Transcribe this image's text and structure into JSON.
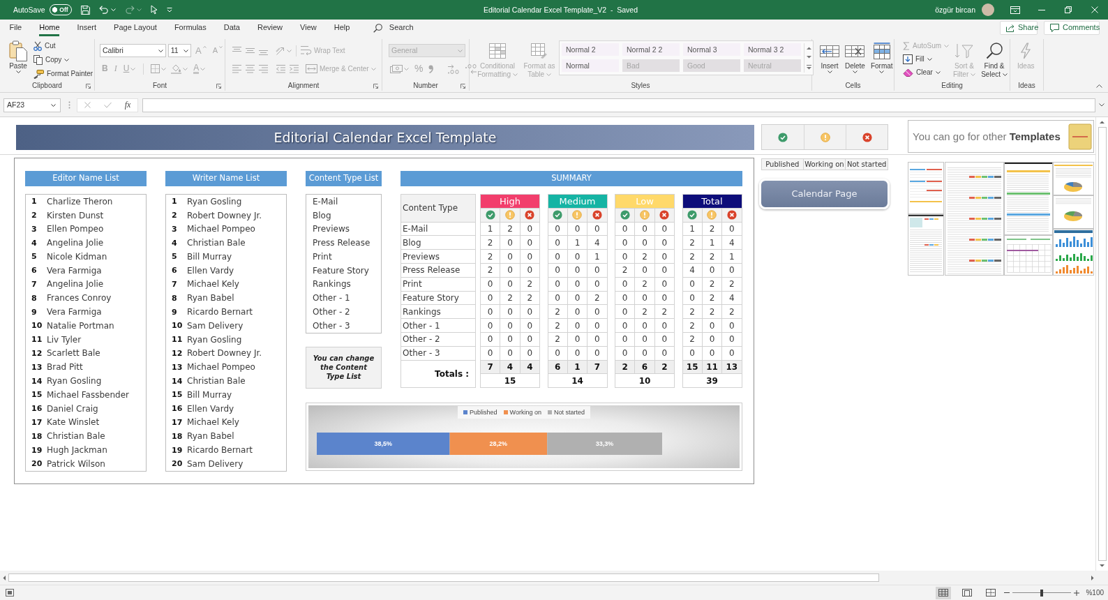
{
  "title_bar": {
    "autosave": {
      "label": "AutoSave",
      "toggle_text": "Off",
      "on": false
    },
    "quick_access": [
      {
        "kind": "save",
        "disabled": false
      },
      {
        "kind": "undo",
        "disabled": false
      },
      {
        "kind": "redo",
        "disabled": true
      },
      {
        "kind": "touch_mode",
        "disabled": false
      },
      {
        "kind": "customize",
        "disabled": false
      }
    ],
    "document_title": "Editorial Calendar Excel Template_V2  -  Saved",
    "user_name": "özgür bircan"
  },
  "ribbon_tabs": [
    {
      "label": "File",
      "selected": false
    },
    {
      "label": "Home",
      "selected": true
    },
    {
      "label": "Insert",
      "selected": false
    },
    {
      "label": "Page Layout",
      "selected": false
    },
    {
      "label": "Formulas",
      "selected": false
    },
    {
      "label": "Data",
      "selected": false
    },
    {
      "label": "Review",
      "selected": false
    },
    {
      "label": "View",
      "selected": false
    },
    {
      "label": "Help",
      "selected": false
    }
  ],
  "tell_me": {
    "label": "Search"
  },
  "share_button": {
    "label": "Share"
  },
  "comments_button": {
    "label": "Comments"
  },
  "ribbon_groups": [
    {
      "kind": "clipboard",
      "label": "Clipboard",
      "launcher": true,
      "commands": [
        {
          "kind": "paste",
          "label": "Paste",
          "disabled": false
        },
        {
          "kind": "cut",
          "label": "Cut",
          "disabled": false
        },
        {
          "kind": "copy",
          "label": "Copy",
          "disabled": false
        },
        {
          "kind": "format_painter",
          "label": "Format Painter",
          "disabled": false
        }
      ]
    },
    {
      "kind": "font",
      "label": "Font",
      "launcher": true,
      "commands": [
        {
          "kind": "font_name",
          "value": "Calibri",
          "disabled": false
        },
        {
          "kind": "font_size",
          "value": "11",
          "disabled": false
        },
        {
          "kind": "grow_font",
          "label": "A",
          "disabled": true
        },
        {
          "kind": "shrink_font",
          "label": "A",
          "disabled": true
        },
        {
          "kind": "bold",
          "label": "B",
          "disabled": true
        },
        {
          "kind": "italic",
          "label": "I",
          "disabled": true
        },
        {
          "kind": "underline",
          "label": "U",
          "disabled": true
        },
        {
          "kind": "borders",
          "disabled": true
        },
        {
          "kind": "fill_color",
          "disabled": true
        },
        {
          "kind": "font_color",
          "label": "A",
          "disabled": true
        }
      ]
    },
    {
      "kind": "alignment",
      "label": "Alignment",
      "launcher": true,
      "commands": [
        {
          "kind": "align_top",
          "disabled": true
        },
        {
          "kind": "align_middle",
          "disabled": true
        },
        {
          "kind": "align_bottom",
          "disabled": true
        },
        {
          "kind": "orientation",
          "disabled": true
        },
        {
          "kind": "wrap_text",
          "label": "Wrap Text",
          "disabled": true
        },
        {
          "kind": "align_left",
          "disabled": true
        },
        {
          "kind": "align_center",
          "disabled": true
        },
        {
          "kind": "align_right",
          "disabled": true
        },
        {
          "kind": "decrease_indent",
          "disabled": true
        },
        {
          "kind": "increase_indent",
          "disabled": true
        },
        {
          "kind": "merge_center",
          "label": "Merge & Center",
          "disabled": true
        }
      ]
    },
    {
      "kind": "number",
      "label": "Number",
      "launcher": true,
      "commands": [
        {
          "kind": "number_format",
          "value": "General",
          "disabled": true
        },
        {
          "kind": "accounting",
          "disabled": true
        },
        {
          "kind": "percent",
          "label": "%",
          "disabled": true
        },
        {
          "kind": "comma",
          "disabled": true
        },
        {
          "kind": "increase_decimal",
          "disabled": true
        },
        {
          "kind": "decrease_decimal",
          "disabled": true
        }
      ]
    },
    {
      "kind": "styles",
      "label": "Styles",
      "launcher": false,
      "commands": [
        {
          "kind": "conditional_formatting",
          "label": "Conditional Formatting",
          "disabled": true
        },
        {
          "kind": "format_as_table",
          "label": "Format as Table",
          "disabled": true
        }
      ],
      "cell_styles": [
        {
          "label": "Normal 2",
          "disabled": false
        },
        {
          "label": "Normal 2 2",
          "disabled": false
        },
        {
          "label": "Normal 3",
          "disabled": false
        },
        {
          "label": "Normal 3 2",
          "disabled": false
        },
        {
          "label": "Normal",
          "disabled": false
        },
        {
          "label": "Bad",
          "disabled": true
        },
        {
          "label": "Good",
          "disabled": true
        },
        {
          "label": "Neutral",
          "disabled": true
        }
      ]
    },
    {
      "kind": "cells",
      "label": "Cells",
      "launcher": false,
      "commands": [
        {
          "kind": "insert",
          "label": "Insert",
          "disabled": false
        },
        {
          "kind": "delete",
          "label": "Delete",
          "disabled": false
        },
        {
          "kind": "format",
          "label": "Format",
          "disabled": false
        }
      ]
    },
    {
      "kind": "editing",
      "label": "Editing",
      "launcher": false,
      "commands": [
        {
          "kind": "autosum",
          "label": "AutoSum",
          "disabled": true
        },
        {
          "kind": "fill",
          "label": "Fill",
          "disabled": false
        },
        {
          "kind": "clear",
          "label": "Clear",
          "disabled": false
        },
        {
          "kind": "sort_filter",
          "label": "Sort & Filter",
          "disabled": true
        },
        {
          "kind": "find_select",
          "label": "Find & Select",
          "disabled": false
        }
      ]
    },
    {
      "kind": "ideas",
      "label": "Ideas",
      "launcher": false,
      "commands": [
        {
          "kind": "ideas",
          "label": "Ideas",
          "disabled": true
        }
      ]
    }
  ],
  "formula_bar": {
    "name_box": "AF23",
    "function_label": "fx"
  },
  "sheet": {
    "banner_title": "Editorial Calendar Excel Template",
    "status_legend": [
      {
        "kind": "published",
        "label": "Published"
      },
      {
        "kind": "working",
        "label": "Working on"
      },
      {
        "kind": "not_started",
        "label": "Not started"
      }
    ],
    "calendar_button": {
      "label": "Calendar Page"
    },
    "templates_promo": {
      "text": "You can go for other **Templates**"
    },
    "editor_list": {
      "title": "Editor Name List",
      "items": [
        {
          "number": "1",
          "name": "Charlize Theron"
        },
        {
          "number": "2",
          "name": "Kirsten Dunst"
        },
        {
          "number": "3",
          "name": "Ellen Pompeo"
        },
        {
          "number": "4",
          "name": "Angelina Jolie"
        },
        {
          "number": "5",
          "name": "Nicole Kidman"
        },
        {
          "number": "6",
          "name": "Vera Farmiga"
        },
        {
          "number": "7",
          "name": "Angelina Jolie"
        },
        {
          "number": "8",
          "name": "Frances Conroy"
        },
        {
          "number": "9",
          "name": "Vera Farmiga"
        },
        {
          "number": "10",
          "name": "Natalie Portman"
        },
        {
          "number": "11",
          "name": "Liv Tyler"
        },
        {
          "number": "12",
          "name": "Scarlett Bale"
        },
        {
          "number": "13",
          "name": "Brad Pitt"
        },
        {
          "number": "14",
          "name": "Ryan Gosling"
        },
        {
          "number": "15",
          "name": "Michael Fassbender"
        },
        {
          "number": "16",
          "name": "Daniel Craig"
        },
        {
          "number": "17",
          "name": "Kate Winslet"
        },
        {
          "number": "18",
          "name": "Christian Bale"
        },
        {
          "number": "19",
          "name": "Hugh Jackman"
        },
        {
          "number": "20",
          "name": "Patrick Wilson"
        }
      ]
    },
    "writer_list": {
      "title": "Writer Name List",
      "items": [
        {
          "number": "1",
          "name": "Ryan Gosling"
        },
        {
          "number": "2",
          "name": "Robert Downey Jr."
        },
        {
          "number": "3",
          "name": "Michael Pompeo"
        },
        {
          "number": "4",
          "name": "Christian Bale"
        },
        {
          "number": "5",
          "name": "Bill Murray"
        },
        {
          "number": "6",
          "name": "Ellen Vardy"
        },
        {
          "number": "7",
          "name": "Michael Kely"
        },
        {
          "number": "8",
          "name": "Ryan Babel"
        },
        {
          "number": "9",
          "name": "Ricardo Bernart"
        },
        {
          "number": "10",
          "name": "Sam Delivery"
        },
        {
          "number": "11",
          "name": "Ryan Gosling"
        },
        {
          "number": "12",
          "name": "Robert Downey Jr."
        },
        {
          "number": "13",
          "name": "Michael Pompeo"
        },
        {
          "number": "14",
          "name": "Christian Bale"
        },
        {
          "number": "15",
          "name": "Bill Murray"
        },
        {
          "number": "16",
          "name": "Ellen Vardy"
        },
        {
          "number": "17",
          "name": "Michael Kely"
        },
        {
          "number": "18",
          "name": "Ryan Babel"
        },
        {
          "number": "19",
          "name": "Ricardo Bernart"
        },
        {
          "number": "20",
          "name": "Sam Delivery"
        }
      ]
    },
    "content_type_list": {
      "title": "Content Type List",
      "items": [
        "E-Mail",
        "Blog",
        "Previews",
        "Press Release",
        "Print",
        "Feature Story",
        "Rankings",
        "Other - 1",
        "Other - 2",
        "Other - 3"
      ],
      "note": "You can change the Content Type List"
    },
    "summary": {
      "title": "SUMMARY",
      "row_header": "Content Type",
      "groups": [
        {
          "label": "High",
          "color": "#f23e6c"
        },
        {
          "label": "Medium",
          "color": "#15b4a4"
        },
        {
          "label": "Low",
          "color": "#ffd96a"
        },
        {
          "label": "Total",
          "color": "#0d0d7a"
        }
      ],
      "rows": [
        {
          "label": "E-Mail",
          "cells": [
            "1",
            "2",
            "0",
            "0",
            "0",
            "0",
            "0",
            "0",
            "0",
            "1",
            "2",
            "0"
          ]
        },
        {
          "label": "Blog",
          "cells": [
            "2",
            "0",
            "0",
            "0",
            "1",
            "4",
            "0",
            "0",
            "0",
            "2",
            "1",
            "4"
          ]
        },
        {
          "label": "Previews",
          "cells": [
            "2",
            "0",
            "0",
            "0",
            "0",
            "1",
            "0",
            "2",
            "0",
            "2",
            "2",
            "1"
          ]
        },
        {
          "label": "Press Release",
          "cells": [
            "2",
            "0",
            "0",
            "0",
            "0",
            "0",
            "2",
            "0",
            "0",
            "4",
            "0",
            "0"
          ]
        },
        {
          "label": "Print",
          "cells": [
            "0",
            "0",
            "2",
            "0",
            "0",
            "0",
            "0",
            "2",
            "0",
            "0",
            "2",
            "2"
          ]
        },
        {
          "label": "Feature Story",
          "cells": [
            "0",
            "2",
            "2",
            "0",
            "0",
            "2",
            "0",
            "0",
            "0",
            "0",
            "2",
            "4"
          ]
        },
        {
          "label": "Rankings",
          "cells": [
            "0",
            "0",
            "0",
            "2",
            "0",
            "0",
            "0",
            "2",
            "2",
            "2",
            "2",
            "2"
          ]
        },
        {
          "label": "Other - 1",
          "cells": [
            "0",
            "0",
            "0",
            "2",
            "0",
            "0",
            "0",
            "0",
            "0",
            "2",
            "0",
            "0"
          ]
        },
        {
          "label": "Other - 2",
          "cells": [
            "0",
            "0",
            "0",
            "2",
            "0",
            "0",
            "0",
            "0",
            "0",
            "2",
            "0",
            "0"
          ]
        },
        {
          "label": "Other - 3",
          "cells": [
            "0",
            "0",
            "0",
            "0",
            "0",
            "0",
            "0",
            "0",
            "0",
            "0",
            "0",
            "0"
          ]
        }
      ],
      "totals_label": "Totals :",
      "totals": [
        "7",
        "4",
        "4",
        "6",
        "1",
        "7",
        "2",
        "6",
        "2",
        "15",
        "11",
        "13"
      ],
      "grand_totals": [
        "15",
        "14",
        "10",
        "39"
      ]
    },
    "chart": {
      "chart_data": {
        "type": "bar",
        "orientation": "horizontal",
        "stacked": true,
        "legend": "top",
        "series": [
          {
            "name": "Published",
            "color": "#5b84cc",
            "values": [
              38.5
            ],
            "value_labels": [
              "38,5%"
            ]
          },
          {
            "name": "Working on",
            "color": "#f0904f",
            "values": [
              28.2
            ],
            "value_labels": [
              "28,2%"
            ]
          },
          {
            "name": "Not started",
            "color": "#b0b0b0",
            "values": [
              33.3
            ],
            "value_labels": [
              "33,3%"
            ]
          }
        ]
      }
    }
  },
  "status_bar": {
    "views": [
      {
        "kind": "normal",
        "selected": true
      },
      {
        "kind": "page_layout",
        "selected": false
      },
      {
        "kind": "page_break",
        "selected": false
      }
    ],
    "zoom": {
      "level": 0.5,
      "label": "%100"
    }
  }
}
